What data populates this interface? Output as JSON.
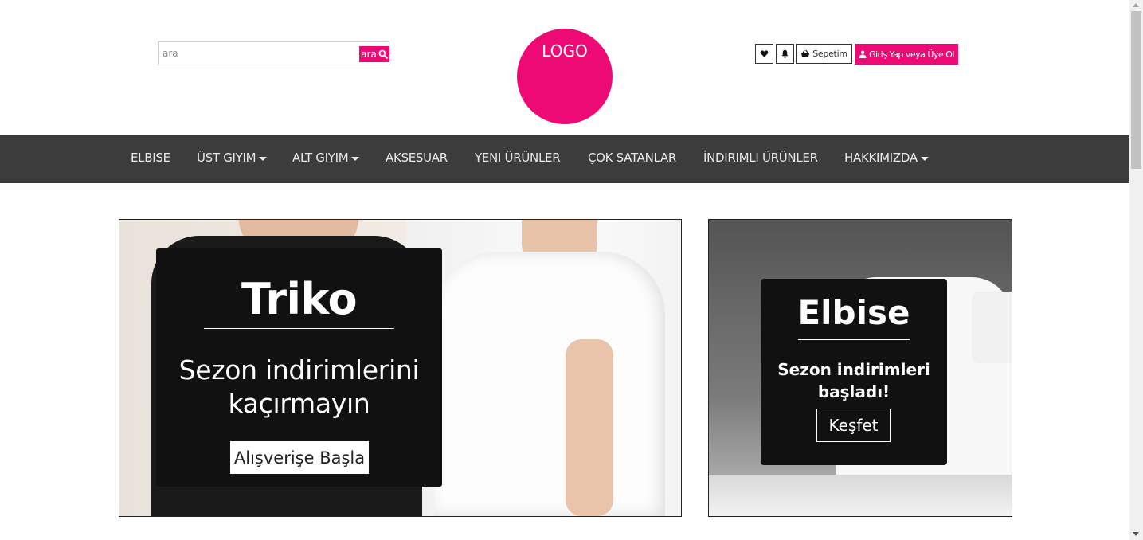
{
  "search": {
    "placeholder": "ara",
    "button_label": "ara"
  },
  "logo": {
    "text": "LOGO"
  },
  "header": {
    "cart_label": "Sepetim",
    "login_label": "Giriş Yap veya Üye Ol"
  },
  "nav": {
    "items": [
      {
        "label": "ELBISE"
      },
      {
        "label": "ÜST GIYIM"
      },
      {
        "label": "ALT GIYIM"
      },
      {
        "label": "AKSESUAR"
      },
      {
        "label": "YENI ÜRÜNLER"
      },
      {
        "label": "ÇOK SATANLAR"
      },
      {
        "label": "İNDIRIMLI ÜRÜNLER"
      },
      {
        "label": "HAKKIMIZDA"
      }
    ]
  },
  "banner_left": {
    "title": "Triko",
    "subtitle_line1": "Sezon indirimlerini",
    "subtitle_line2": "kaçırmayın",
    "button": "Alışverişe Başla"
  },
  "banner_right": {
    "title": "Elbise",
    "subtitle_line1": "Sezon indirimleri",
    "subtitle_line2": "başladı!",
    "button": "Keşfet"
  },
  "colors": {
    "accent": "#ee0a74",
    "navbar": "#3c3c3c"
  }
}
